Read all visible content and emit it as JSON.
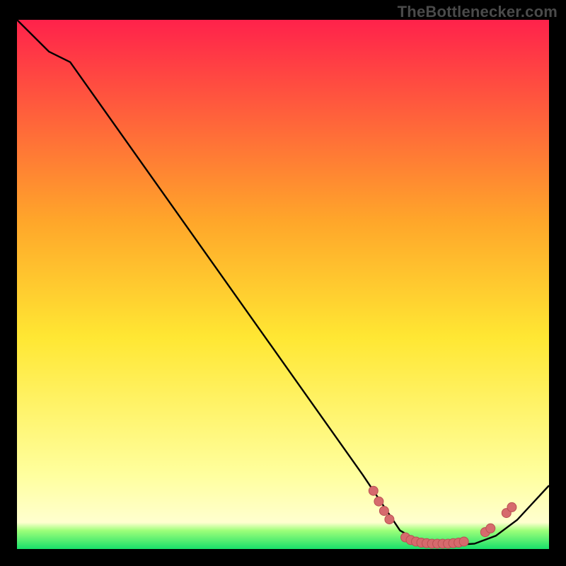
{
  "watermark": "TheBottlenecker.com",
  "colors": {
    "bg": "#000000",
    "curve": "#000000",
    "marker_fill": "#d66a6d",
    "marker_stroke": "#b94f52",
    "green_band": "#18e06a",
    "gradient_top": "#ff224b",
    "gradient_mid_high": "#ffa62a",
    "gradient_mid": "#ffe733",
    "gradient_low": "#ffff9e"
  },
  "chart_data": {
    "type": "line",
    "title": "",
    "xlabel": "",
    "ylabel": "",
    "xlim": [
      0,
      100
    ],
    "ylim": [
      0,
      100
    ],
    "curve": [
      {
        "x": 0,
        "y": 100
      },
      {
        "x": 6,
        "y": 94
      },
      {
        "x": 10,
        "y": 92
      },
      {
        "x": 65,
        "y": 14
      },
      {
        "x": 72,
        "y": 3.5
      },
      {
        "x": 76,
        "y": 1.2
      },
      {
        "x": 80,
        "y": 0.6
      },
      {
        "x": 86,
        "y": 1.0
      },
      {
        "x": 90,
        "y": 2.5
      },
      {
        "x": 94,
        "y": 5.5
      },
      {
        "x": 100,
        "y": 12
      }
    ],
    "markers": [
      {
        "x": 67,
        "y": 11.0
      },
      {
        "x": 68,
        "y": 9.0
      },
      {
        "x": 69,
        "y": 7.2
      },
      {
        "x": 70,
        "y": 5.6
      },
      {
        "x": 73,
        "y": 2.2
      },
      {
        "x": 74,
        "y": 1.7
      },
      {
        "x": 75,
        "y": 1.4
      },
      {
        "x": 76,
        "y": 1.2
      },
      {
        "x": 77,
        "y": 1.1
      },
      {
        "x": 78,
        "y": 1.0
      },
      {
        "x": 79,
        "y": 1.0
      },
      {
        "x": 80,
        "y": 1.0
      },
      {
        "x": 81,
        "y": 1.0
      },
      {
        "x": 82,
        "y": 1.1
      },
      {
        "x": 83,
        "y": 1.2
      },
      {
        "x": 84,
        "y": 1.4
      },
      {
        "x": 88,
        "y": 3.2
      },
      {
        "x": 89,
        "y": 3.9
      },
      {
        "x": 92,
        "y": 6.8
      },
      {
        "x": 93,
        "y": 7.9
      }
    ]
  }
}
